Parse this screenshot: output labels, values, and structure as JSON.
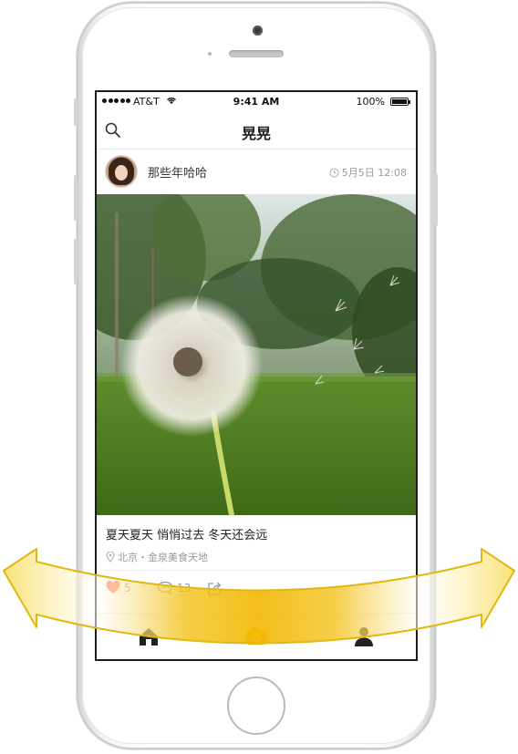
{
  "status_bar": {
    "carrier": "AT&T",
    "time": "9:41 AM",
    "battery": "100%"
  },
  "nav": {
    "title": "晃晃",
    "search_icon": "search-icon"
  },
  "post": {
    "username": "那些年哈哈",
    "time": "5月5日 12:08",
    "caption": "夏天夏天 悄悄过去 冬天还会远",
    "location": "北京・金泉美食天地",
    "likes": "5",
    "comments": "13"
  },
  "tab_bar": {
    "icons": [
      "home-icon",
      "camera-icon",
      "profile-icon"
    ]
  },
  "colors": {
    "like": "#ff6b3d",
    "arrow_gold": "#f5c518",
    "arrow_outline": "#e0b812"
  }
}
